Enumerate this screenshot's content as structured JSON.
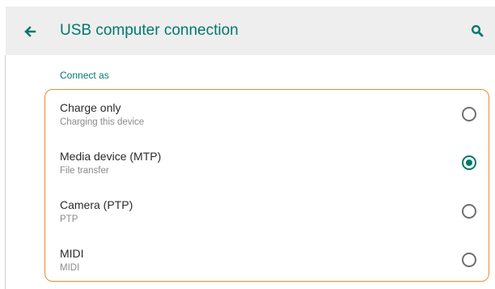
{
  "header": {
    "back_icon": "arrow-left-icon",
    "title": "USB computer connection",
    "search_icon": "search-icon",
    "accent_color": "#00796b"
  },
  "section": {
    "label": "Connect as"
  },
  "options": [
    {
      "title": "Charge only",
      "subtitle": "Charging this device",
      "selected": false
    },
    {
      "title": "Media device (MTP)",
      "subtitle": "File transfer",
      "selected": true
    },
    {
      "title": "Camera (PTP)",
      "subtitle": "PTP",
      "selected": false
    },
    {
      "title": "MIDI",
      "subtitle": "MIDI",
      "selected": false
    }
  ],
  "highlight_color": "#f0882c"
}
